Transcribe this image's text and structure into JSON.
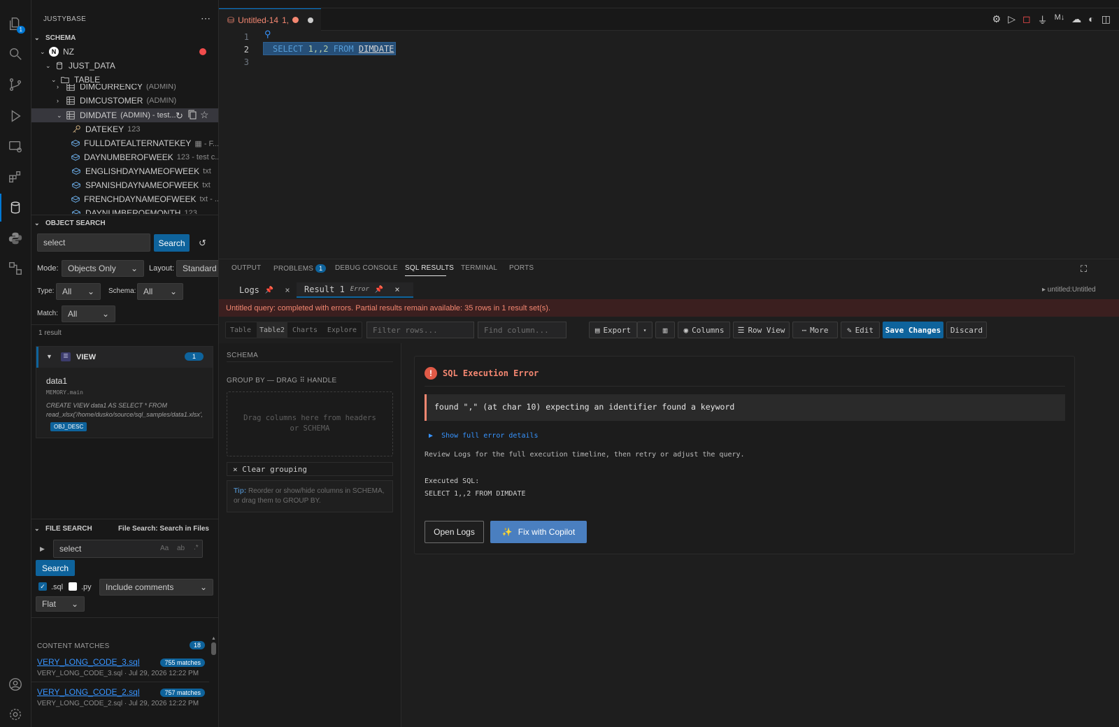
{
  "sidebar": {
    "title": "JUSTYBASE",
    "more_icon": "⋯",
    "schema_section": "SCHEMA",
    "tree": {
      "connection": "NZ",
      "connection_letter": "N",
      "database": "JUST_DATA",
      "folder": "TABLE",
      "tables": [
        {
          "name": "DIMCURRENCY",
          "owner": "(ADMIN)"
        },
        {
          "name": "DIMCUSTOMER",
          "owner": "(ADMIN)"
        },
        {
          "name": "DIMDATE",
          "owner": "(ADMIN) - test..."
        }
      ],
      "columns": [
        {
          "name": "DATEKEY",
          "type": "123"
        },
        {
          "name": "FULLDATEALTERNATEKEY",
          "type": "▦ - F..."
        },
        {
          "name": "DAYNUMBEROFWEEK",
          "type": "123 - test c..."
        },
        {
          "name": "ENGLISHDAYNAMEOFWEEK",
          "type": "txt"
        },
        {
          "name": "SPANISHDAYNAMEOFWEEK",
          "type": "txt"
        },
        {
          "name": "FRENCHDAYNAMEOFWEEK",
          "type": "txt - ..."
        },
        {
          "name": "DAYNUMBEROFMONTH",
          "type": "123"
        }
      ]
    },
    "object_search": {
      "header": "OBJECT SEARCH",
      "query": "select",
      "search_label": "Search",
      "refresh_icon": "↺",
      "mode_label": "Mode:",
      "mode_value": "Objects Only",
      "layout_label": "Layout:",
      "layout_value": "Standard L",
      "type_label": "Type:",
      "type_value": "All",
      "schema_label": "Schema:",
      "schema_value": "All",
      "match_label": "Match:",
      "match_value": "All",
      "result_count": "1 result",
      "group": {
        "label": "VIEW",
        "count": "1"
      },
      "result": {
        "name": "data1",
        "location": "MEMORY.main",
        "definition": "CREATE VIEW data1 AS SELECT * FROM read_xlsx('/home/dusko/source/sql_samples/data1.xlsx',",
        "tag": "OBJ_DESC"
      }
    },
    "file_search": {
      "header": "FILE SEARCH",
      "subtitle": "File Search: Search in Files",
      "query": "select",
      "opt_case": "Aa",
      "opt_word": "ab",
      "opt_regex": ".*",
      "search_label": "Search",
      "ext_sql": ".sql",
      "ext_py": ".py",
      "comments_value": "Include comments",
      "view_value": "Flat",
      "matches_header": "CONTENT MATCHES",
      "matches_count": "18",
      "matches": [
        {
          "file": "VERY_LONG_CODE_3.sql",
          "count": "755 matches",
          "meta": "VERY_LONG_CODE_3.sql · Jul 29, 2026 12:22 PM"
        },
        {
          "file": "VERY_LONG_CODE_2.sql",
          "count": "757 matches",
          "meta": "VERY_LONG_CODE_2.sql · Jul 29, 2026 12:22 PM"
        }
      ]
    }
  },
  "activity": {
    "explorer_badge": "1"
  },
  "editor": {
    "tab_title": "Untitled-14",
    "tab_suffix": "1,",
    "line_numbers": [
      "1",
      "2",
      "3"
    ],
    "code_line2": {
      "kw1": "SELECT",
      "nums": "1,,2",
      "kw2": "FROM",
      "table": "DIMDATE"
    }
  },
  "panel": {
    "tabs": [
      {
        "label": "OUTPUT"
      },
      {
        "label": "PROBLEMS",
        "badge": "1"
      },
      {
        "label": "DEBUG CONSOLE"
      },
      {
        "label": "SQL RESULTS"
      },
      {
        "label": "TERMINAL"
      },
      {
        "label": "PORTS"
      }
    ],
    "result_tabs": {
      "logs": "Logs",
      "result": "Result 1",
      "error_badge": "Error",
      "source": "▸ untitled:Untitled"
    },
    "status_message": "Untitled query: completed with errors. Partial results remain available: 35 rows in 1 result set(s).",
    "toolbar": {
      "views": [
        "Table",
        "Table2",
        "Charts",
        "Explore"
      ],
      "filter_placeholder": "Filter rows...",
      "find_placeholder": "Find column...",
      "export": "Export",
      "columns": "Columns",
      "row_view": "Row View",
      "more": "More",
      "edit": "Edit",
      "save": "Save Changes",
      "discard": "Discard"
    },
    "schema_pane": {
      "title": "SCHEMA",
      "group_by": "GROUP BY — DRAG ⠿ HANDLE",
      "drop_hint": "Drag columns here from headers or SCHEMA",
      "clear": "Clear grouping",
      "tip_label": "Tip:",
      "tip_text": "Reorder or show/hide columns in SCHEMA, or drag them to GROUP BY."
    },
    "error": {
      "title": "SQL Execution Error",
      "message": "found \",\" (at char 10) expecting an identifier found a keyword",
      "details_toggle": "Show full error details",
      "review": "Review Logs for the full execution timeline, then retry or adjust the query.",
      "executed_label": "Executed SQL:",
      "executed_sql": "SELECT 1,,2 FROM DIMDATE",
      "open_logs": "Open Logs",
      "fix": "Fix with Copilot"
    }
  },
  "colors": {
    "accent": "#0e639c",
    "error": "#f48771",
    "error_bar": "#3b1f1f"
  }
}
